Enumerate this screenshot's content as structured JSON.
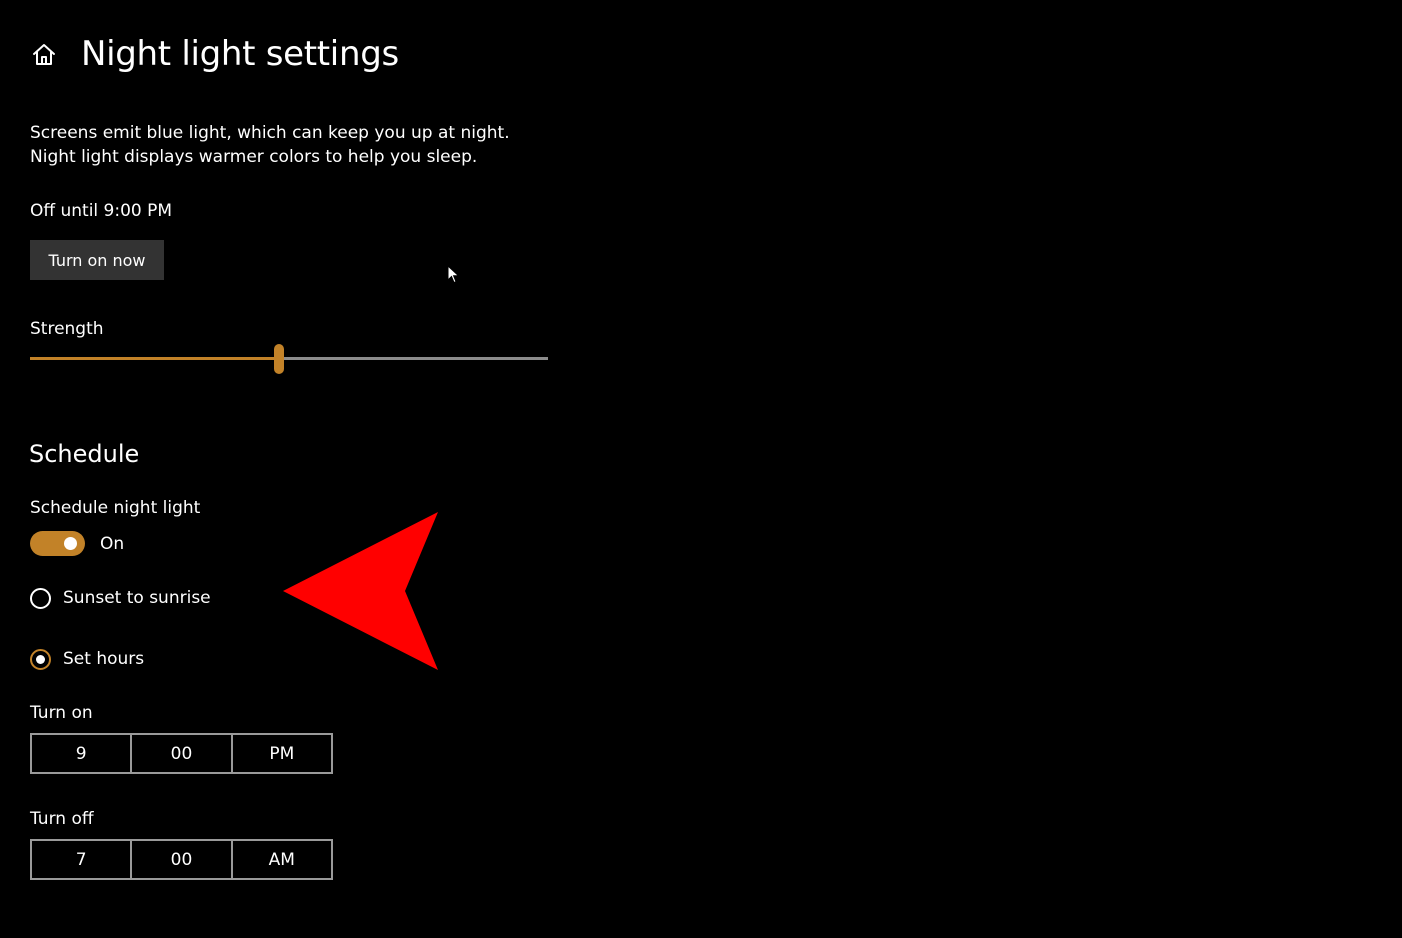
{
  "header": {
    "title": "Night light settings",
    "icon": "home-icon"
  },
  "description": "Screens emit blue light, which can keep you up at night. Night light displays warmer colors to help you sleep.",
  "status": {
    "text": "Off until 9:00 PM"
  },
  "actions": {
    "turn_on_now_label": "Turn on now"
  },
  "strength": {
    "label": "Strength",
    "value_fraction": 0.48
  },
  "schedule": {
    "section_title": "Schedule",
    "toggle_label": "Schedule night light",
    "toggle_state": "On",
    "toggle_on": true,
    "options": [
      {
        "label": "Sunset to sunrise",
        "selected": false
      },
      {
        "label": "Set hours",
        "selected": true
      }
    ],
    "turn_on": {
      "label": "Turn on",
      "hour": "9",
      "minute": "00",
      "period": "PM"
    },
    "turn_off": {
      "label": "Turn off",
      "hour": "7",
      "minute": "00",
      "period": "AM"
    }
  },
  "colors": {
    "background": "#000000",
    "accent": "#c28228",
    "button_bg": "#333333",
    "annotation_arrow": "#ff0000"
  }
}
